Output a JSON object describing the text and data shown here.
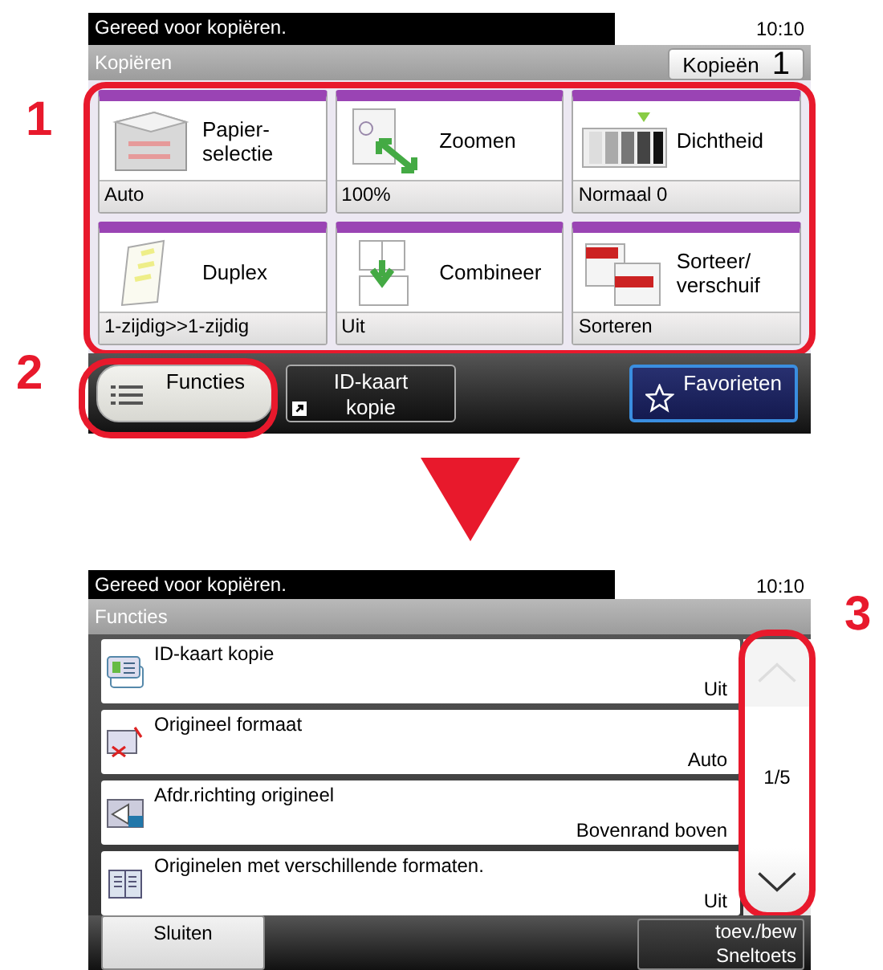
{
  "screen_1": {
    "status": "Gereed voor kopiëren.",
    "time": "10:10",
    "title": "Kopiëren",
    "copies": {
      "label": "Kopieën",
      "value": "1"
    },
    "tiles": [
      {
        "kind": "paper",
        "label": "Papier-\nselectie",
        "value": "Auto"
      },
      {
        "kind": "zoom",
        "label": "Zoomen",
        "value": "100%"
      },
      {
        "kind": "density",
        "label": "Dichtheid",
        "value": "Normaal 0"
      },
      {
        "kind": "duplex",
        "label": "Duplex",
        "value": "1-zijdig>>1-zijdig"
      },
      {
        "kind": "combine",
        "label": "Combineer",
        "value": "Uit"
      },
      {
        "kind": "sort",
        "label": "Sorteer/\nverschuif",
        "value": "Sorteren"
      }
    ],
    "bottom_buttons": [
      {
        "kind": "functions",
        "label": "Functies",
        "selected": true
      },
      {
        "kind": "shortcut",
        "label": "ID-kaart\nkopie",
        "selected": false
      },
      {
        "kind": "favorites",
        "label": "Favorieten",
        "selected": false
      }
    ]
  },
  "screen_2": {
    "status": "Gereed voor kopiëren.",
    "time": "10:10",
    "title": "Functies",
    "rows": [
      {
        "kind": "idcard",
        "label": "ID-kaart kopie",
        "value": "Uit"
      },
      {
        "kind": "size",
        "label": "Origineel formaat",
        "value": "Auto"
      },
      {
        "kind": "orientation",
        "label": "Afdr.richting origineel",
        "value": "Bovenrand boven"
      },
      {
        "kind": "mixed",
        "label": "Originelen met verschillende formaten.",
        "value": "Uit"
      }
    ],
    "scroll": {
      "up_disabled": true,
      "page": "1/5",
      "down_disabled": false
    },
    "bottom_buttons": [
      {
        "label": "Sluiten"
      },
      {
        "label": "toev./bew\nSneltoets"
      }
    ]
  },
  "callouts": [
    "1",
    "2",
    "3"
  ]
}
